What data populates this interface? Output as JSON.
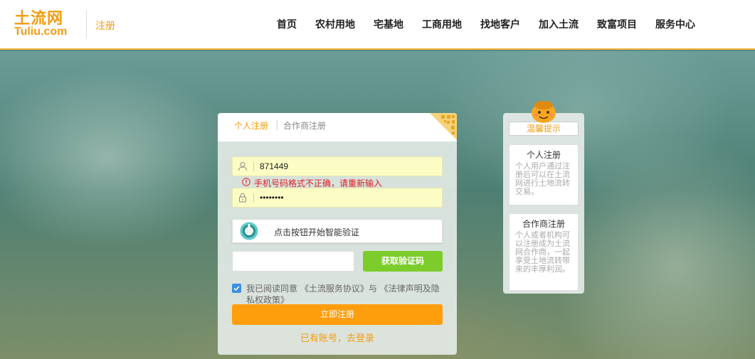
{
  "header": {
    "logo_cn": "土流网",
    "logo_en": "Tuliu.com",
    "page_label": "注册",
    "nav": [
      "首页",
      "农村用地",
      "宅基地",
      "工商用地",
      "找地客户",
      "加入土流",
      "致富项目",
      "服务中心"
    ]
  },
  "register": {
    "tabs": {
      "personal": "个人注册",
      "partner": "合作商注册"
    },
    "phone_value": "871449",
    "error_text": "手机号码格式不正确，请重新输入",
    "password_mask": "••••••••",
    "captcha_text": "点击按钮开始智能验证",
    "code_placeholder": "",
    "get_code_label": "获取验证码",
    "agree_text": "我已阅读同意 《土流服务协议》与 《法律声明及隐私权政策》",
    "submit_label": "立即注册",
    "login_link": "已有账号，去登录"
  },
  "tips": {
    "title": "温馨提示",
    "cards": [
      {
        "title": "个人注册",
        "body": "个人用户通过注册后可以在土流网进行土地流转交易。"
      },
      {
        "title": "合作商注册",
        "body": "个人或者机构可以注册成为土流网合作商，一起享受土地流转带来的丰厚利润。"
      }
    ]
  },
  "colors": {
    "brand": "#f39c12",
    "submit": "#ff9e0c",
    "get_code": "#7ccc2c",
    "error": "#e02020",
    "field_highlight": "#fbfdc4"
  }
}
